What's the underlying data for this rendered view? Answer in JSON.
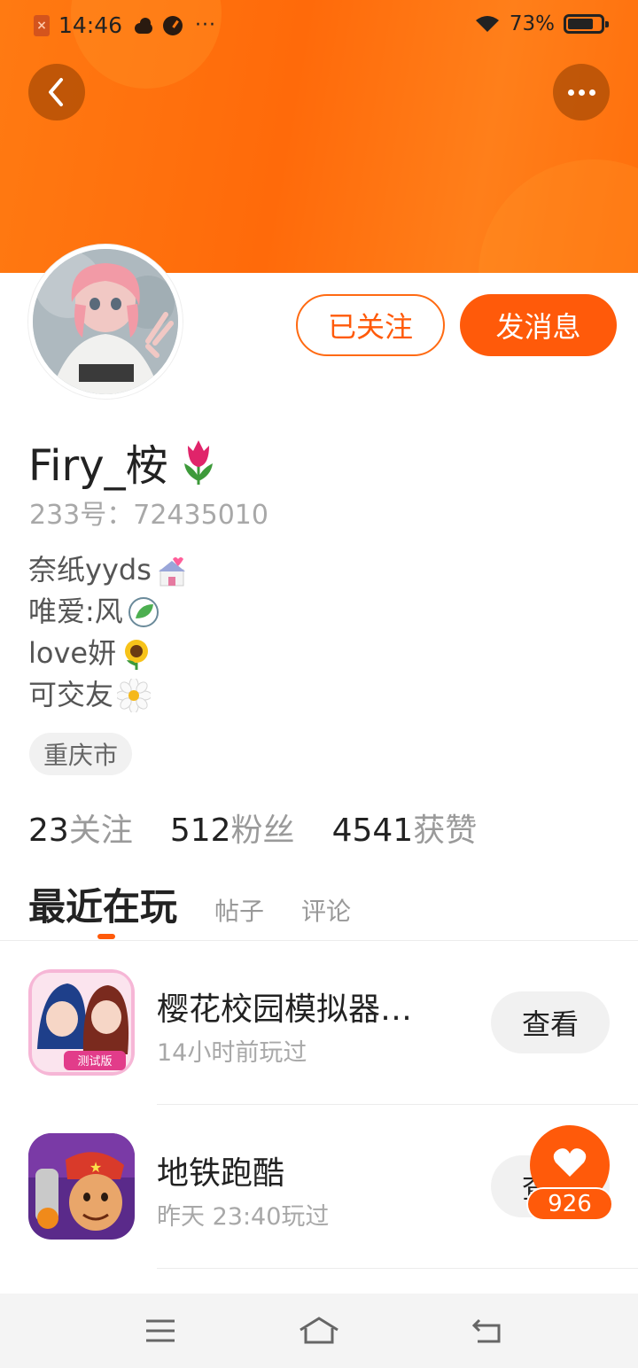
{
  "status_bar": {
    "time": "14:46",
    "more": "···",
    "battery": "73%"
  },
  "header": {
    "back_icon": "chevron-left-icon",
    "more_icon": "more-horizontal-icon"
  },
  "profile": {
    "follow_label": "已关注",
    "message_label": "发消息",
    "username": "Firy_桉",
    "uid": "233号：72435010",
    "bio": [
      {
        "text": "奈纸yyds",
        "emoji": "wedding-chapel-icon"
      },
      {
        "text": "唯爱:风",
        "emoji": "leaf-wind-icon"
      },
      {
        "text": "love妍",
        "emoji": "sunflower-icon"
      },
      {
        "text": "可交友",
        "emoji": "daisy-icon"
      }
    ],
    "location": "重庆市",
    "stats": [
      {
        "num": "23",
        "label": "关注"
      },
      {
        "num": "512",
        "label": "粉丝"
      },
      {
        "num": "4541",
        "label": "获赞"
      }
    ]
  },
  "tabs": [
    {
      "label": "最近在玩",
      "active": true
    },
    {
      "label": "帖子",
      "active": false
    },
    {
      "label": "评论",
      "active": false
    }
  ],
  "games": [
    {
      "title": "樱花校园模拟器…",
      "played": "14小时前玩过",
      "button": "查看"
    },
    {
      "title": "地铁跑酷",
      "played": "昨天 23:40玩过",
      "button": "查看"
    }
  ],
  "like": {
    "count": "926"
  },
  "colors": {
    "accent": "#ff5a0a",
    "banner": "#ff7a12"
  }
}
